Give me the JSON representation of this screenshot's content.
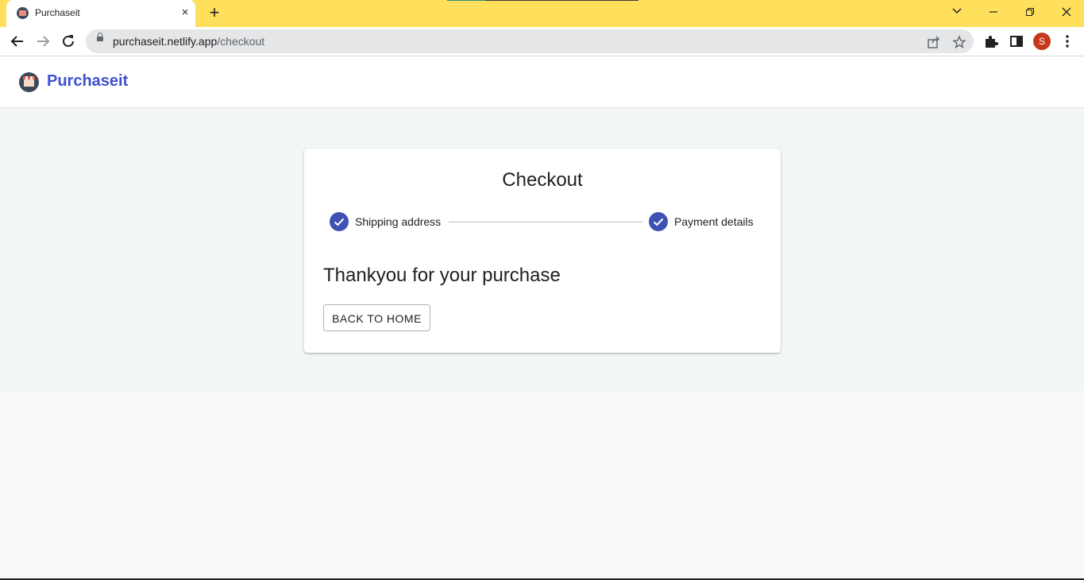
{
  "browser": {
    "tab": {
      "title": "Purchaseit",
      "close_icon": "×"
    },
    "new_tab_icon": "+",
    "url": {
      "domain": "purchaseit.netlify.app",
      "path": "/checkout"
    },
    "profile_initial": "S"
  },
  "app": {
    "brand": "Purchaseit"
  },
  "checkout": {
    "title": "Checkout",
    "steps": [
      {
        "label": "Shipping address",
        "state": "completed"
      },
      {
        "label": "Payment details",
        "state": "completed"
      }
    ],
    "message": "Thankyou for your purchase",
    "back_button": "BACK TO HOME"
  },
  "colors": {
    "tabstrip": "#fee05c",
    "brand": "#3f51d0",
    "step_complete": "#3f51b5",
    "content_bg": "#f2f6f6"
  }
}
